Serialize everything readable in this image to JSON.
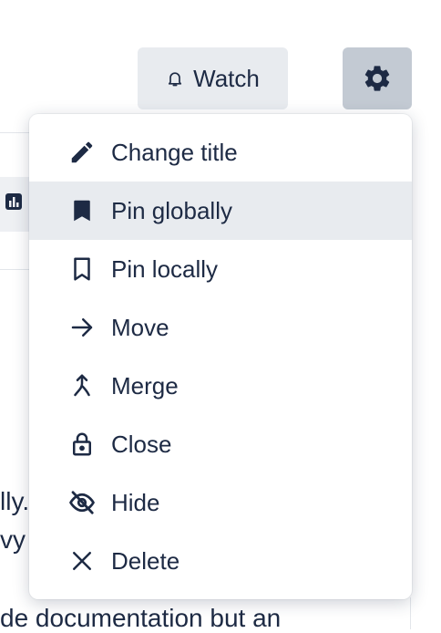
{
  "header": {
    "watch_label": "Watch",
    "watch_icon": "bell-icon",
    "settings_icon": "gear-icon"
  },
  "menu": {
    "items": [
      {
        "label": "Change title",
        "icon": "pencil-icon",
        "active": false
      },
      {
        "label": "Pin globally",
        "icon": "bookmark-filled-icon",
        "active": true
      },
      {
        "label": "Pin locally",
        "icon": "bookmark-outline-icon",
        "active": false
      },
      {
        "label": "Move",
        "icon": "arrow-right-icon",
        "active": false
      },
      {
        "label": "Merge",
        "icon": "merge-icon",
        "active": false
      },
      {
        "label": "Close",
        "icon": "lock-icon",
        "active": false
      },
      {
        "label": "Hide",
        "icon": "eye-off-icon",
        "active": false
      },
      {
        "label": "Delete",
        "icon": "x-icon",
        "active": false
      }
    ]
  },
  "background_text": {
    "line1": "lly.",
    "line2": "vy",
    "line3": "de documentation but an"
  },
  "colors": {
    "text": "#1d2a44",
    "button_bg": "#e8ebef",
    "gear_button_bg": "#c3cad3",
    "active_item_bg": "#e8ebef"
  }
}
